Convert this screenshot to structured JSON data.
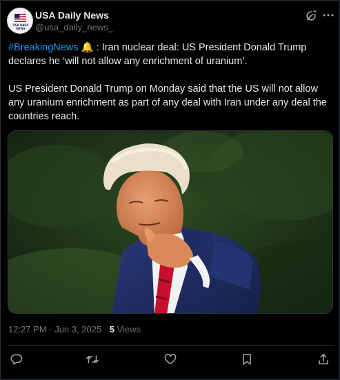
{
  "author": {
    "display_name": "USA Daily News",
    "handle": "@usa_daily_news_",
    "avatar_text": "USA DAILY NEWS"
  },
  "post": {
    "hashtag": "#BreakingNews",
    "emoji": "🔔",
    "headline": " : Iran nuclear deal: US President Donald Trump declares he ‘will not allow any enrichment of uranium’.",
    "body": "US President Donald Trump on Monday said that the US will not allow any uranium enrichment as part of any deal with Iran under any deal the countries reach."
  },
  "meta": {
    "time_date": "12:27 PM · Jun 3, 2025 · ",
    "views_count": "5",
    "views_label": " Views"
  },
  "icons": {
    "grok": "grok-icon",
    "more": "more-icon",
    "reply": "reply-icon",
    "repost": "repost-icon",
    "like": "like-icon",
    "bookmark": "bookmark-icon",
    "share": "share-icon"
  },
  "colors": {
    "background": "#000000",
    "text": "#e7e9ea",
    "secondary": "#71767b",
    "accent": "#1d9bf0",
    "border": "#2f3336"
  }
}
